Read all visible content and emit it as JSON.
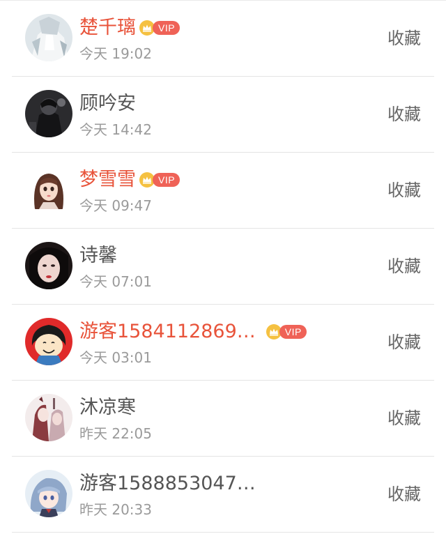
{
  "users": [
    {
      "name": "楚千璃",
      "time": "今天 19:02",
      "vip": true,
      "vip_label": "VIP",
      "action": "收藏",
      "avatar": "avatar-anime-white"
    },
    {
      "name": "顾吟安",
      "time": "今天 14:42",
      "vip": false,
      "action": "收藏",
      "avatar": "avatar-dark-figure"
    },
    {
      "name": "梦雪雪",
      "time": "今天 09:47",
      "vip": true,
      "vip_label": "VIP",
      "action": "收藏",
      "avatar": "avatar-cartoon-girl"
    },
    {
      "name": "诗馨",
      "time": "今天 07:01",
      "vip": false,
      "action": "收藏",
      "avatar": "avatar-photo-girl"
    },
    {
      "name": "游客1584112869…",
      "time": "今天 03:01",
      "vip": true,
      "vip_label": "VIP",
      "action": "收藏",
      "avatar": "avatar-charlie-brown-red"
    },
    {
      "name": "沐凉寒",
      "time": "昨天 22:05",
      "vip": false,
      "action": "收藏",
      "avatar": "avatar-sketch-girl"
    },
    {
      "name": "游客1588853047…",
      "time": "昨天 20:33",
      "vip": false,
      "action": "收藏",
      "avatar": "avatar-anime-blue-hair"
    }
  ],
  "colors": {
    "vip_name": "#e8533a",
    "normal_name": "#555555",
    "vip_pill": "#ef6257",
    "crown": "#f5c141"
  }
}
